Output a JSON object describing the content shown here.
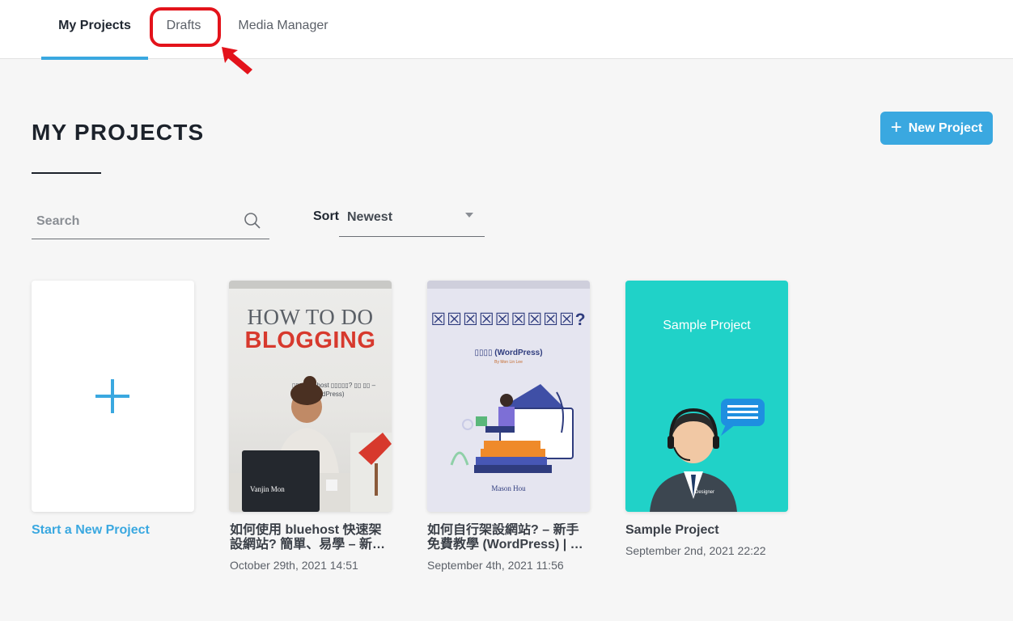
{
  "tabs": [
    {
      "label": "My Projects",
      "active": true
    },
    {
      "label": "Drafts",
      "active": false
    },
    {
      "label": "Media Manager",
      "active": false
    }
  ],
  "page": {
    "title": "MY PROJECTS",
    "new_project_label": "New Project"
  },
  "search": {
    "placeholder": "Search"
  },
  "sort": {
    "label": "Sort",
    "value": "Newest"
  },
  "new_card": {
    "label": "Start a New Project"
  },
  "projects": [
    {
      "title": "如何使用 bluehost 快速架設網站? 簡單、易學 – 新…",
      "date": "October 29th, 2021 14:51",
      "thumb": {
        "line1": "HOW TO DO",
        "line2": "BLOGGING",
        "subtitle": "▯▯▯ bluehost ▯▯▯▯▯? ▯▯ ▯▯ – ▯▯▯▯ (WordPress)",
        "author": "Vanjin Mon"
      }
    },
    {
      "title": "如何自行架設網站? – 新手免費教學 (WordPress) | …",
      "date": "September 4th, 2021 11:56",
      "thumb": {
        "title": "☒☒☒☒☒☒☒☒☒?",
        "subtitle": "▯▯▯▯ (WordPress)",
        "byline": "By Mon Lin Lee",
        "author": "Mason Hou"
      }
    },
    {
      "title": "Sample Project",
      "date": "September 2nd, 2021 22:22",
      "thumb": {
        "title": "Sample Project",
        "role": "Designer"
      }
    }
  ],
  "colors": {
    "accent": "#3aa8e0",
    "highlight": "#e3131b",
    "sample_bg": "#20d2c8"
  }
}
